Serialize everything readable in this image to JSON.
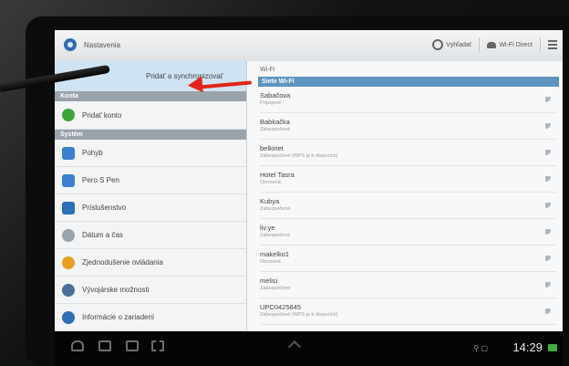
{
  "app": {
    "title": "Nastavenia"
  },
  "actionbar": {
    "search_label": "Vyhľadať",
    "wifi_direct_label": "Wi-Fi Direct"
  },
  "left": {
    "top_item": "Pridať a synchronizovať",
    "section_konto": "Konta",
    "add_account": "Pridať konto",
    "section_system": "Systém",
    "items": [
      {
        "label": "Pohyb",
        "icon": "motion-icon",
        "color": "#3a7fd0"
      },
      {
        "label": "Pero S Pen",
        "icon": "spen-icon",
        "color": "#3a7fd0"
      },
      {
        "label": "Príslušenstvo",
        "icon": "accessory-icon",
        "color": "#2f6fb8"
      },
      {
        "label": "Dátum a čas",
        "icon": "clock-icon",
        "color": "#9aa3ab"
      },
      {
        "label": "Zjednodušenie ovládania",
        "icon": "accessibility-icon",
        "color": "#e8a020"
      },
      {
        "label": "Vývojárske možnosti",
        "icon": "developer-icon",
        "color": "#4a6f9b"
      },
      {
        "label": "Informácie o zariadení",
        "icon": "info-icon",
        "color": "#2f6fb8"
      }
    ]
  },
  "right": {
    "heading": "Wi-Fi",
    "section": "Siete Wi-Fi",
    "networks": [
      {
        "name": "Sabačova",
        "status": "Pripojené"
      },
      {
        "name": "Babkačka",
        "status": "Zabezpečené"
      },
      {
        "name": "belkinet",
        "status": "Zabezpečené (WPS je k dispozícii)"
      },
      {
        "name": "Hotel Tasra",
        "status": "Otvorená"
      },
      {
        "name": "Kubya",
        "status": "Zabezpečené"
      },
      {
        "name": "liv.ye",
        "status": "Zabezpečené"
      },
      {
        "name": "makelko1",
        "status": "Otvorená"
      },
      {
        "name": "melisi",
        "status": "Zabezpečené"
      },
      {
        "name": "UPC0425845",
        "status": "Zabezpečené (WPS je k dispozícii)"
      }
    ]
  },
  "statusbar": {
    "time": "14:29"
  },
  "colors": {
    "accent": "#5f94c1",
    "arrow": "#e2231a",
    "selected": "#cfe3f2"
  }
}
